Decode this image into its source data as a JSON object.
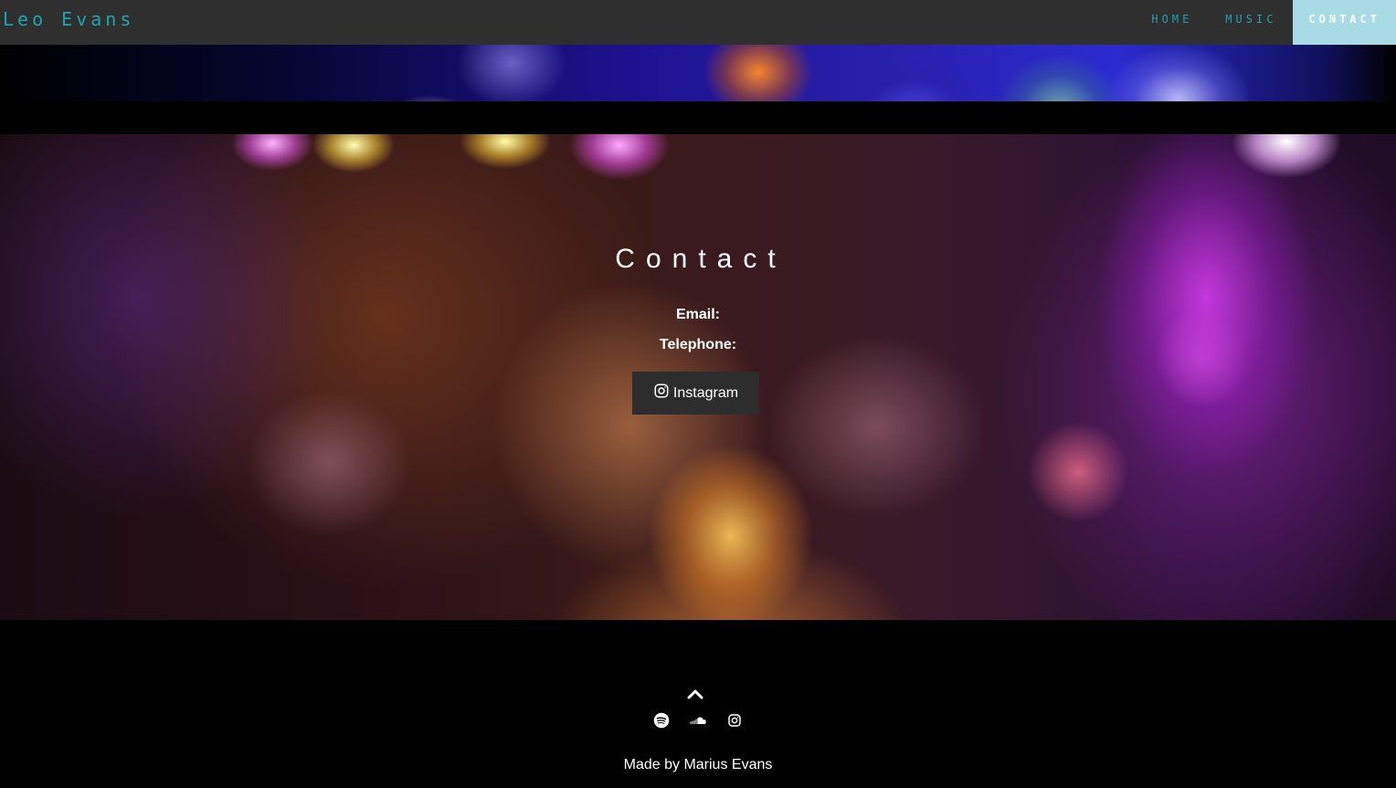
{
  "navbar": {
    "brand": "Leo Evans",
    "items": [
      {
        "label": "HOME",
        "active": false
      },
      {
        "label": "MUSIC",
        "active": false
      },
      {
        "label": "CONTACT",
        "active": true
      }
    ]
  },
  "hero": {
    "title": "Contact",
    "email_label": "Email:",
    "telephone_label": "Telephone:",
    "instagram_button": "Instagram"
  },
  "footer": {
    "scroll_top_icon": "chevron-up-icon",
    "socials": [
      "spotify-icon",
      "soundcloud-icon",
      "instagram-icon"
    ],
    "credit": "Made by Marius Evans"
  },
  "colors": {
    "navbar_bg": "#2f2f2f",
    "accent": "#1fa3b1",
    "active_nav_bg": "#a9dbe6",
    "button_bg": "#2d2d2d"
  }
}
